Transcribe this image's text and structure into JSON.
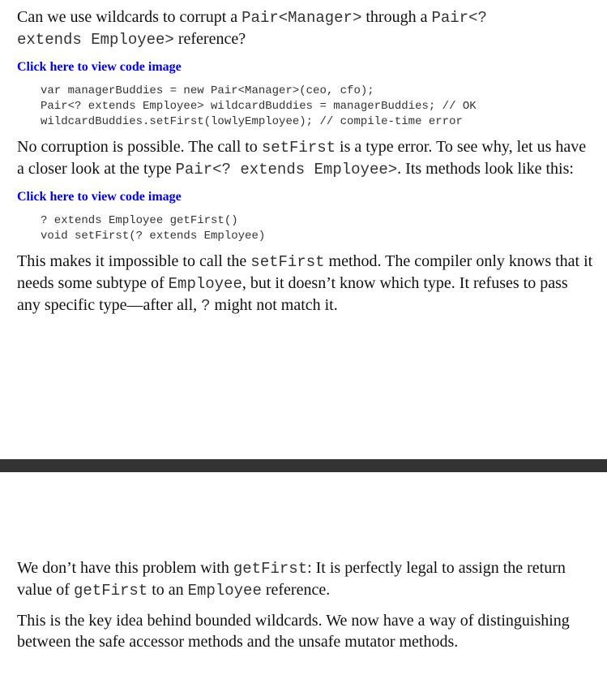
{
  "top": {
    "question": {
      "t1": "Can we use wildcards to corrupt a ",
      "c1": "Pair<Manager>",
      "t2": " through a ",
      "c2": "Pair<?",
      "c3": "extends Employee>",
      "t3": " reference?"
    },
    "link1": "Click here to view code image",
    "code1": [
      "var managerBuddies = new Pair<Manager>(ceo, cfo);",
      "Pair<? extends Employee> wildcardBuddies = managerBuddies; // OK",
      "wildcardBuddies.setFirst(lowlyEmployee); // compile-time error"
    ],
    "para2": {
      "t1": "No corruption is possible. The call to ",
      "c1": "setFirst",
      "t2": " is a type error. To see why, let us have a closer look at the type ",
      "c2": "Pair<? extends Employee>",
      "t3": ". Its methods look like this:"
    },
    "link2": "Click here to view code image",
    "code2": [
      "? extends Employee getFirst()",
      "void setFirst(? extends Employee)"
    ],
    "para3": {
      "t1": "This makes it impossible to call the ",
      "c1": "setFirst",
      "t2": " method. The compiler only knows that it needs some subtype of ",
      "c2": "Employee",
      "t3": ", but it doesn’t know which type. It refuses to pass any specific type—after all, ",
      "c3": "?",
      "t4": " might not match it."
    }
  },
  "bottom": {
    "para4": {
      "t1": "We don’t have this problem with ",
      "c1": "getFirst",
      "t2": ": It is perfectly legal to assign the return value of ",
      "c2": "getFirst",
      "t3": " to an ",
      "c3": "Employee",
      "t4": " reference."
    },
    "para5": "This is the key idea behind bounded wildcards. We now have a way of distinguishing between the safe accessor methods and the unsafe mutator methods."
  }
}
